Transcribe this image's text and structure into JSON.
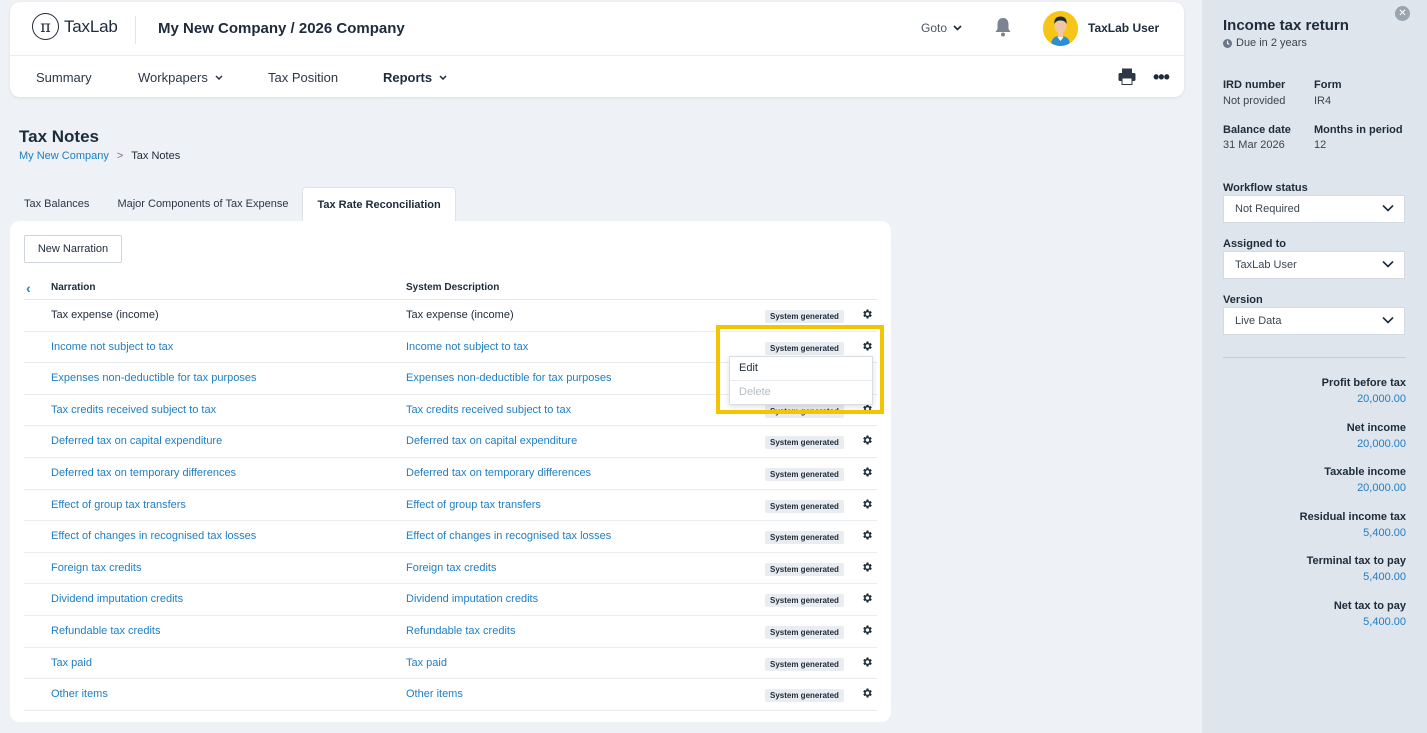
{
  "app": {
    "logo_text": "TaxLab",
    "company_title": "My New Company / 2026 Company"
  },
  "header": {
    "goto_label": "Goto",
    "user_name": "TaxLab User"
  },
  "nav": {
    "items": [
      {
        "label": "Summary"
      },
      {
        "label": "Workpapers"
      },
      {
        "label": "Tax Position"
      },
      {
        "label": "Reports"
      }
    ]
  },
  "page": {
    "title": "Tax Notes",
    "breadcrumb": {
      "link": "My New Company",
      "separator": ">",
      "current": "Tax Notes"
    }
  },
  "tabs": [
    {
      "label": "Tax Balances"
    },
    {
      "label": "Major Components of Tax Expense"
    },
    {
      "label": "Tax Rate Reconciliation"
    }
  ],
  "table": {
    "new_button": "New Narration",
    "columns": {
      "narration": "Narration",
      "system_description": "System Description"
    },
    "badge_label": "System generated",
    "rows": [
      {
        "narration": "Tax expense (income)",
        "system_description": "Tax expense (income)"
      },
      {
        "narration": "Income not subject to tax",
        "system_description": "Income not subject to tax"
      },
      {
        "narration": "Expenses non-deductible for tax purposes",
        "system_description": "Expenses non-deductible for tax purposes"
      },
      {
        "narration": "Tax credits received subject to tax",
        "system_description": "Tax credits received subject to tax"
      },
      {
        "narration": "Deferred tax on capital expenditure",
        "system_description": "Deferred tax on capital expenditure"
      },
      {
        "narration": "Deferred tax on temporary differences",
        "system_description": "Deferred tax on temporary differences"
      },
      {
        "narration": "Effect of group tax transfers",
        "system_description": "Effect of group tax transfers"
      },
      {
        "narration": "Effect of changes in recognised tax losses",
        "system_description": "Effect of changes in recognised tax losses"
      },
      {
        "narration": "Foreign tax credits",
        "system_description": "Foreign tax credits"
      },
      {
        "narration": "Dividend imputation credits",
        "system_description": "Dividend imputation credits"
      },
      {
        "narration": "Refundable tax credits",
        "system_description": "Refundable tax credits"
      },
      {
        "narration": "Tax paid",
        "system_description": "Tax paid"
      },
      {
        "narration": "Other items",
        "system_description": "Other items"
      }
    ],
    "context_menu": {
      "edit": "Edit",
      "delete": "Delete"
    }
  },
  "sidebar": {
    "title": "Income tax return",
    "due": "Due in 2 years",
    "ird_label": "IRD number",
    "ird_value": "Not provided",
    "form_label": "Form",
    "form_value": "IR4",
    "balance_label": "Balance date",
    "balance_value": "31 Mar 2026",
    "months_label": "Months in period",
    "months_value": "12",
    "workflow_label": "Workflow status",
    "workflow_value": "Not Required",
    "assigned_label": "Assigned to",
    "assigned_value": "TaxLab User",
    "version_label": "Version",
    "version_value": "Live Data",
    "summary": [
      {
        "label": "Profit before tax",
        "value": "20,000.00"
      },
      {
        "label": "Net income",
        "value": "20,000.00"
      },
      {
        "label": "Taxable income",
        "value": "20,000.00"
      },
      {
        "label": "Residual income tax",
        "value": "5,400.00"
      },
      {
        "label": "Terminal tax to pay",
        "value": "5,400.00"
      },
      {
        "label": "Net tax to pay",
        "value": "5,400.00"
      }
    ]
  },
  "colors": {
    "link": "#1f7ec2",
    "highlight": "#f2c500",
    "avatar": "#f5c518"
  },
  "icons": [
    "logo-pi-icon",
    "chevron-down-icon",
    "bell-icon",
    "avatar-icon",
    "printer-icon",
    "more-icon",
    "chevron-left-icon",
    "gear-icon",
    "close-icon",
    "clock-icon"
  ]
}
